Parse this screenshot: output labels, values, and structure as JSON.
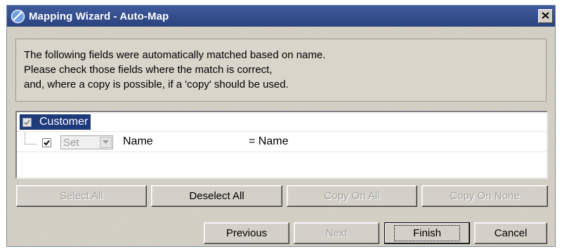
{
  "window": {
    "title": "Mapping Wizard - Auto-Map"
  },
  "info": {
    "lines": [
      "The following fields were automatically matched based on name.",
      "Please check those fields where the match is correct,",
      "and, where a copy is possible, if a 'copy' should be used."
    ]
  },
  "tree": {
    "root": {
      "label": "Customer",
      "checked": true,
      "enabled": false
    },
    "children": [
      {
        "checked": true,
        "mode": "Set",
        "mode_enabled": false,
        "field": "Name",
        "match": "= Name"
      }
    ]
  },
  "buttons": {
    "select_all": "Select All",
    "deselect_all": "Deselect All",
    "copy_on_all": "Copy On All",
    "copy_on_none": "Copy On None",
    "previous": "Previous",
    "next": "Next",
    "finish": "Finish",
    "cancel": "Cancel"
  },
  "colors": {
    "titlebar": "#2b447f",
    "selection": "#1f3a7a",
    "dialog_bg": "#d6d2c8"
  }
}
